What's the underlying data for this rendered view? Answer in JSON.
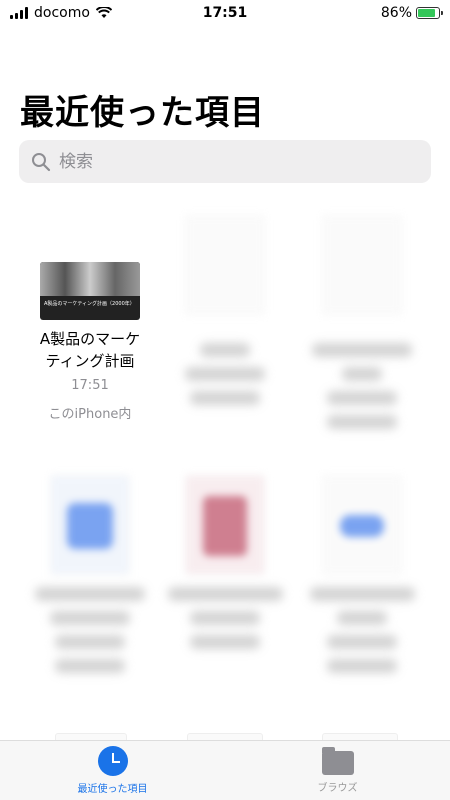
{
  "status": {
    "carrier": "docomo",
    "time": "17:51",
    "battery": "86%",
    "battery_level": 0.86
  },
  "title": "最近使った項目",
  "search": {
    "placeholder": "検索"
  },
  "files": [
    {
      "name_line1": "A製品のマーケ",
      "name_line2": "ティング計画",
      "time": "17:51",
      "location": "このiPhone内",
      "thumb_caption": "A製品のマーケティング計画（2000年）"
    }
  ],
  "tabs": [
    {
      "label": "最近使った項目",
      "icon": "clock-icon",
      "active": true
    },
    {
      "label": "ブラウズ",
      "icon": "folder-icon",
      "active": false
    }
  ],
  "colors": {
    "accent": "#1a73e8",
    "battery": "#34c759"
  }
}
